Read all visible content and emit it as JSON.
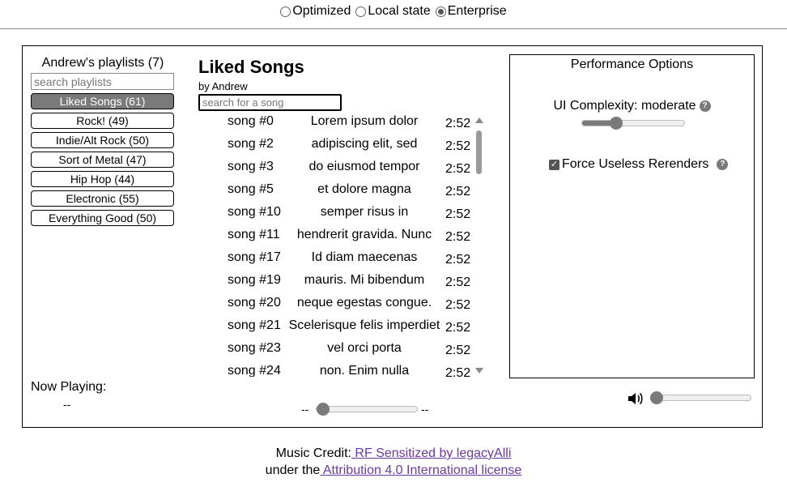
{
  "modes": [
    {
      "label": "Optimized",
      "selected": false
    },
    {
      "label": "Local state",
      "selected": false
    },
    {
      "label": "Enterprise",
      "selected": true
    }
  ],
  "sidebar": {
    "title": "Andrew's playlists (7)",
    "search_placeholder": "search playlists",
    "playlists": [
      {
        "label": "Liked Songs (61)",
        "active": true
      },
      {
        "label": "Rock! (49)",
        "active": false
      },
      {
        "label": "Indie/Alt Rock (50)",
        "active": false
      },
      {
        "label": "Sort of Metal (47)",
        "active": false
      },
      {
        "label": "Hip Hop (44)",
        "active": false
      },
      {
        "label": "Electronic (55)",
        "active": false
      },
      {
        "label": "Everything Good (50)",
        "active": false
      }
    ]
  },
  "now_playing": {
    "label": "Now Playing:",
    "value": "--"
  },
  "playlist": {
    "title": "Liked Songs",
    "by": "by Andrew",
    "search_placeholder": "search for a song",
    "songs": [
      {
        "num": "song #0",
        "name": "Lorem ipsum dolor",
        "duration": "2:52"
      },
      {
        "num": "song #2",
        "name": "adipiscing elit, sed",
        "duration": "2:52"
      },
      {
        "num": "song #3",
        "name": "do eiusmod tempor",
        "duration": "2:52"
      },
      {
        "num": "song #5",
        "name": "et dolore magna",
        "duration": "2:52"
      },
      {
        "num": "song #10",
        "name": "semper risus in",
        "duration": "2:52"
      },
      {
        "num": "song #11",
        "name": "hendrerit gravida. Nunc",
        "duration": "2:52"
      },
      {
        "num": "song #17",
        "name": "Id diam maecenas",
        "duration": "2:52"
      },
      {
        "num": "song #19",
        "name": "mauris. Mi bibendum",
        "duration": "2:52"
      },
      {
        "num": "song #20",
        "name": "neque egestas congue.",
        "duration": "2:52"
      },
      {
        "num": "song #21",
        "name": "Scelerisque felis imperdiet",
        "duration": "2:52"
      },
      {
        "num": "song #23",
        "name": "vel orci porta",
        "duration": "2:52"
      },
      {
        "num": "song #24",
        "name": "non. Enim nulla",
        "duration": "2:52"
      }
    ]
  },
  "player": {
    "elapsed": "--",
    "remaining": "--",
    "progress": 0,
    "volume": 0.03
  },
  "performance": {
    "title": "Performance Options",
    "complexity_label": "UI Complexity: moderate",
    "complexity_level": 0.33,
    "force_label": "Force Useless Rerenders",
    "force_checked": true
  },
  "footer": {
    "credit_prefix": "Music Credit:",
    "credit_link": " RF Sensitized by legacyAlli",
    "license_prefix": "under the",
    "license_link": " Attribution 4.0 International license"
  },
  "colors": {
    "accent": "#7a7a7a",
    "link": "#6a3aa0"
  }
}
